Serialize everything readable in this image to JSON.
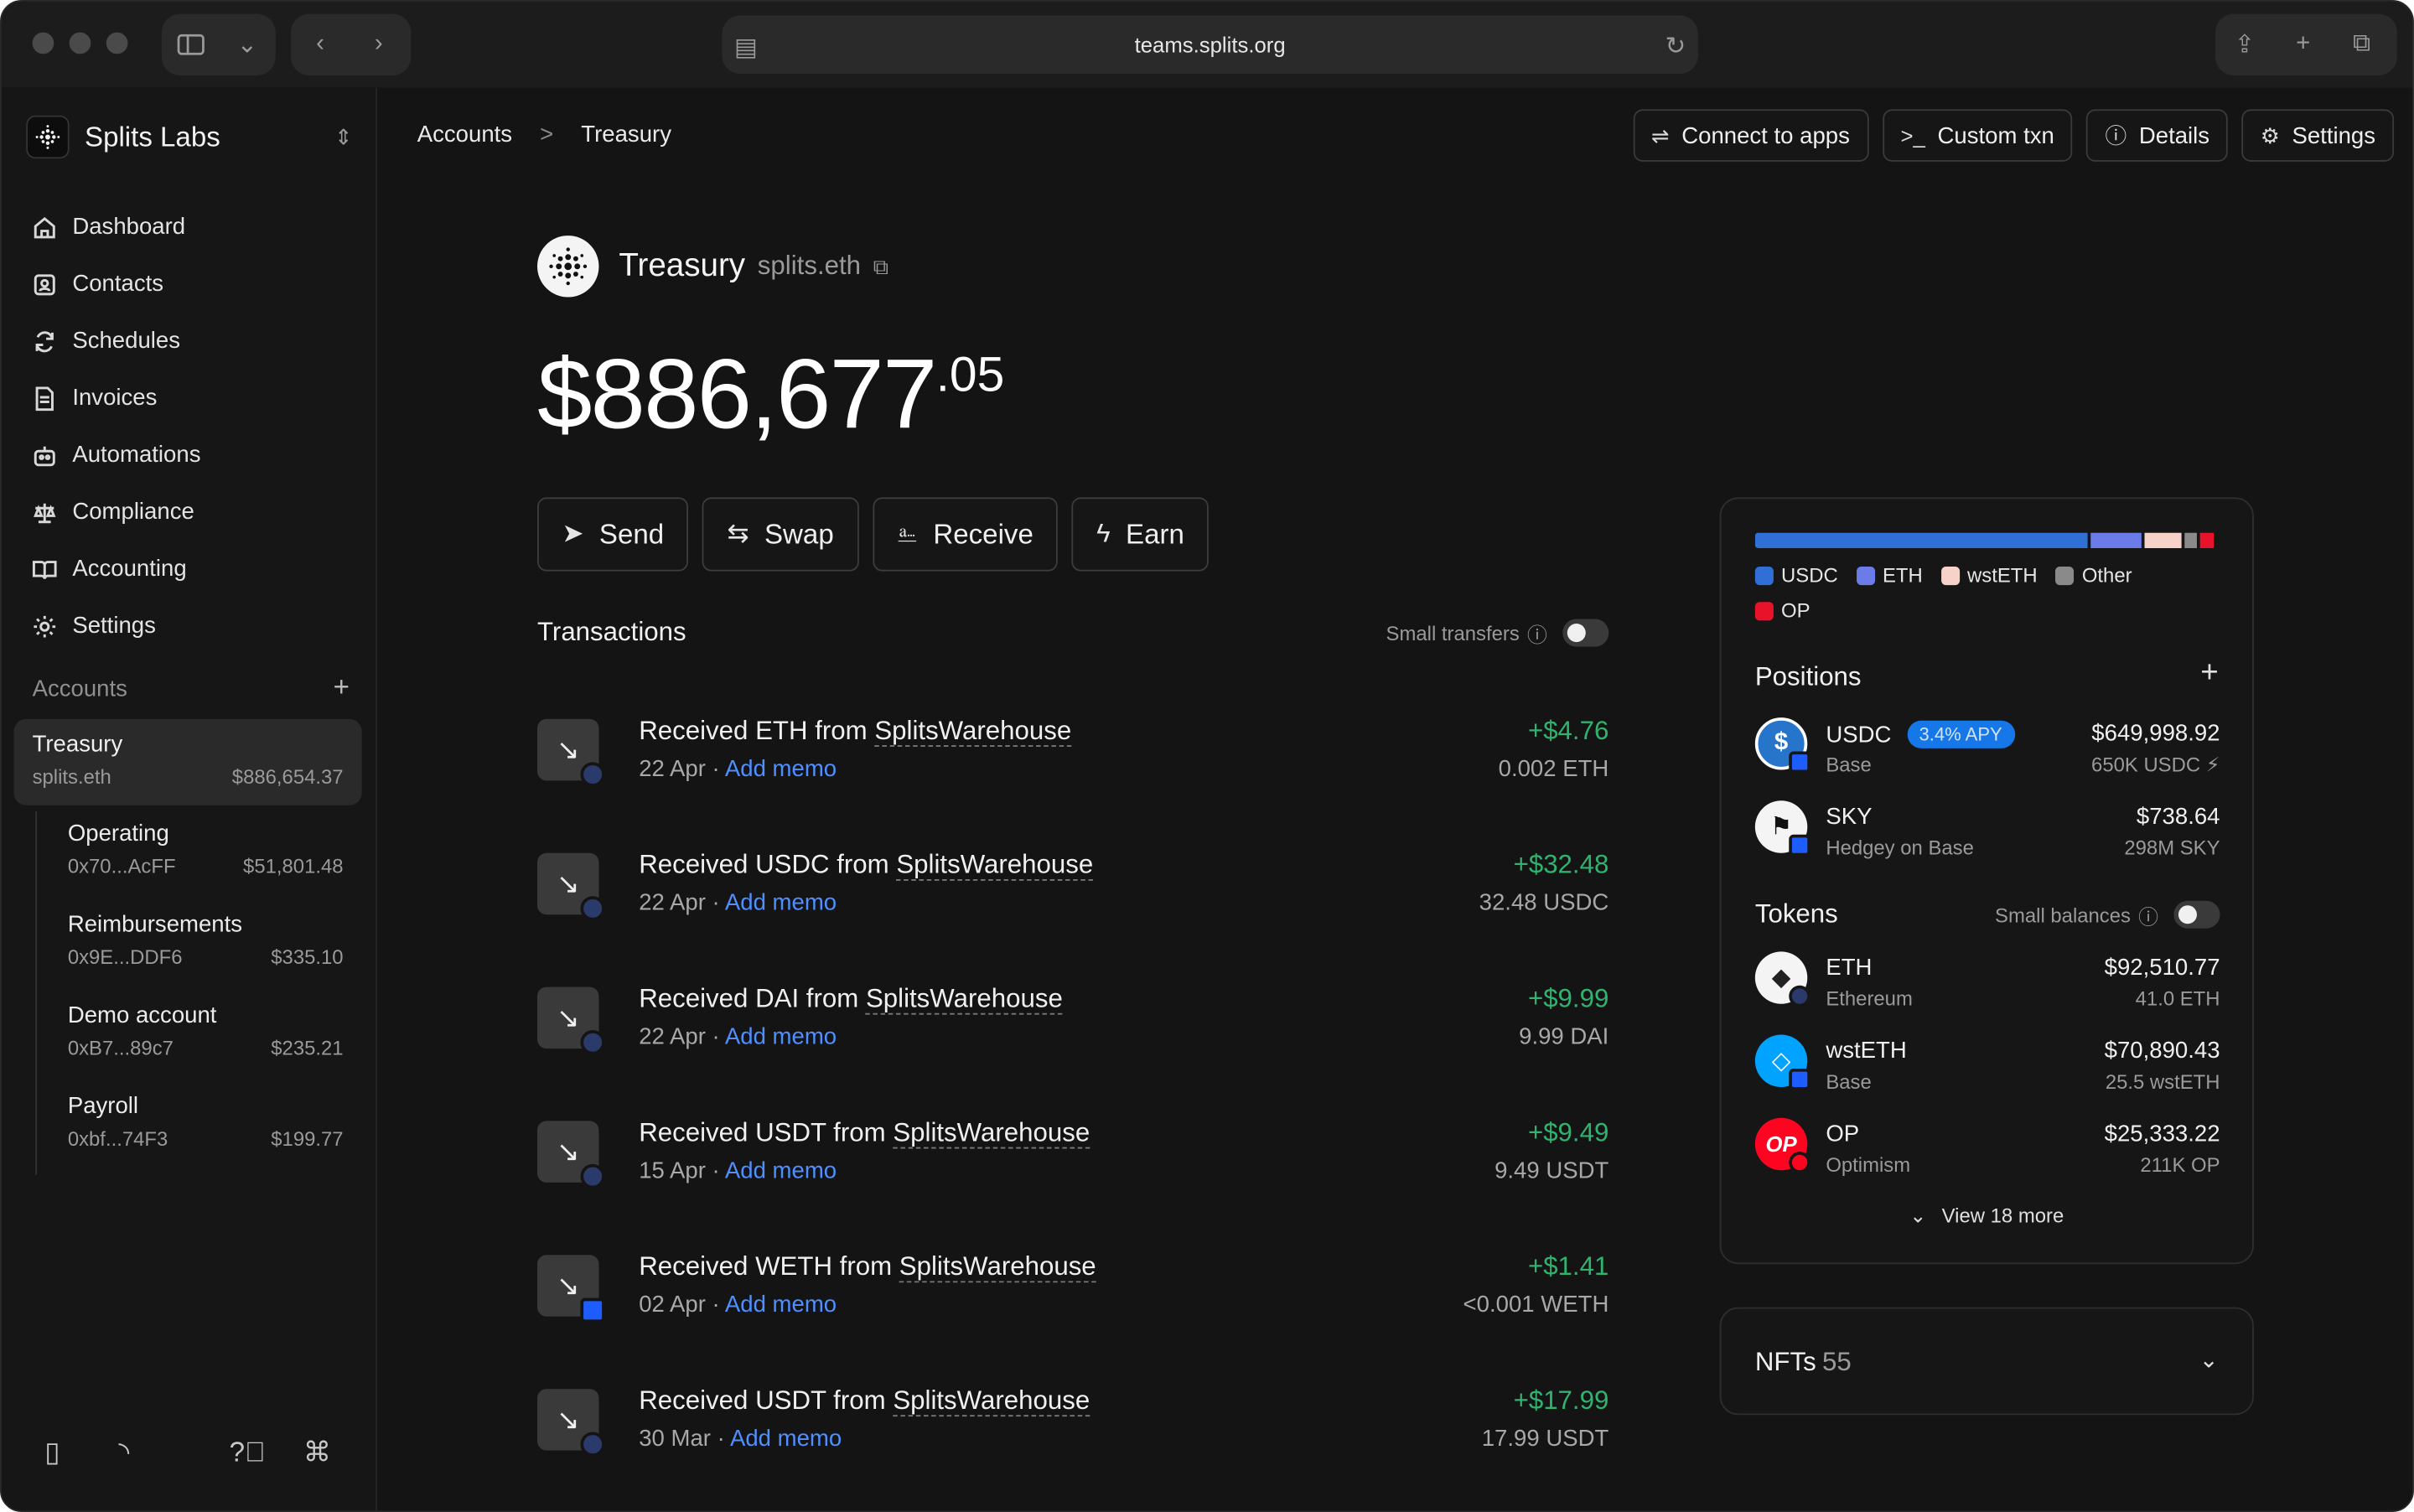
{
  "browser": {
    "url": "teams.splits.org"
  },
  "org": {
    "name": "Splits Labs"
  },
  "nav": [
    {
      "label": "Dashboard",
      "icon": "home-icon"
    },
    {
      "label": "Contacts",
      "icon": "contact-icon"
    },
    {
      "label": "Schedules",
      "icon": "refresh-icon"
    },
    {
      "label": "Invoices",
      "icon": "invoice-icon"
    },
    {
      "label": "Automations",
      "icon": "robot-icon"
    },
    {
      "label": "Compliance",
      "icon": "scale-icon"
    },
    {
      "label": "Accounting",
      "icon": "book-icon"
    },
    {
      "label": "Settings",
      "icon": "gear-icon"
    }
  ],
  "accounts": {
    "heading": "Accounts",
    "main": {
      "name": "Treasury",
      "ens": "splits.eth",
      "balance": "$886,654.37"
    },
    "subs": [
      {
        "name": "Operating",
        "address": "0x70...AcFF",
        "balance": "$51,801.48"
      },
      {
        "name": "Reimbursements",
        "address": "0x9E...DDF6",
        "balance": "$335.10"
      },
      {
        "name": "Demo account",
        "address": "0xB7...89c7",
        "balance": "$235.21"
      },
      {
        "name": "Payroll",
        "address": "0xbf...74F3",
        "balance": "$199.77"
      }
    ]
  },
  "breadcrumb": {
    "root": "Accounts",
    "sep": ">",
    "current": "Treasury"
  },
  "top_actions": {
    "connect": "Connect to apps",
    "custom": "Custom txn",
    "details": "Details",
    "settings": "Settings"
  },
  "account": {
    "title": "Treasury",
    "ens": "splits.eth",
    "balance_main": "$886,677",
    "balance_cents": ".05"
  },
  "actions": {
    "send": "Send",
    "swap": "Swap",
    "receive": "Receive",
    "earn": "Earn"
  },
  "transactions": {
    "title": "Transactions",
    "toggle_label": "Small transfers",
    "memo_label": "Add memo",
    "items": [
      {
        "prefix": "Received ETH from ",
        "source": "SplitsWarehouse",
        "date": "22 Apr",
        "amount": "+$4.76",
        "qty": "0.002 ETH",
        "badge": "eth"
      },
      {
        "prefix": "Received USDC from ",
        "source": "SplitsWarehouse",
        "date": "22 Apr",
        "amount": "+$32.48",
        "qty": "32.48 USDC",
        "badge": "eth"
      },
      {
        "prefix": "Received DAI from ",
        "source": "SplitsWarehouse",
        "date": "22 Apr",
        "amount": "+$9.99",
        "qty": "9.99 DAI",
        "badge": "eth"
      },
      {
        "prefix": "Received USDT from ",
        "source": "SplitsWarehouse",
        "date": "15 Apr",
        "amount": "+$9.49",
        "qty": "9.49 USDT",
        "badge": "eth"
      },
      {
        "prefix": "Received WETH from ",
        "source": "SplitsWarehouse",
        "date": "02 Apr",
        "amount": "+$1.41",
        "qty": "<0.001 WETH",
        "badge": "base"
      },
      {
        "prefix": "Received USDT from ",
        "source": "SplitsWarehouse",
        "date": "30 Mar",
        "amount": "+$17.99",
        "qty": "17.99 USDT",
        "badge": "eth"
      }
    ]
  },
  "allocation": {
    "segments": [
      {
        "name": "USDC",
        "share": 0.733,
        "color": "#2f6fd6"
      },
      {
        "name": "ETH",
        "share": 0.114,
        "color": "#6b7ce8"
      },
      {
        "name": "wstETH",
        "share": 0.08,
        "color": "#f6d2c8"
      },
      {
        "name": "Other",
        "share": 0.03,
        "color": "#8a8a8a"
      },
      {
        "name": "OP",
        "share": 0.029,
        "color": "#e8132a"
      }
    ]
  },
  "positions": {
    "title": "Positions",
    "items": [
      {
        "name": "USDC",
        "apy": "3.4% APY",
        "network": "Base",
        "value": "$649,998.92",
        "qty": "650K USDC ⚡"
      },
      {
        "name": "SKY",
        "apy": "",
        "network": "Hedgey on Base",
        "value": "$738.64",
        "qty": "298M SKY"
      }
    ]
  },
  "tokens": {
    "title": "Tokens",
    "toggle_label": "Small balances",
    "items": [
      {
        "name": "ETH",
        "network": "Ethereum",
        "value": "$92,510.77",
        "qty": "41.0 ETH",
        "logo_text": ""
      },
      {
        "name": "wstETH",
        "network": "Base",
        "value": "$70,890.43",
        "qty": "25.5 wstETH",
        "logo_text": ""
      },
      {
        "name": "OP",
        "network": "Optimism",
        "value": "$25,333.22",
        "qty": "211K OP",
        "logo_text": "OP"
      }
    ],
    "view_more": "View 18 more"
  },
  "nfts": {
    "label": "NFTs",
    "count": "55"
  }
}
